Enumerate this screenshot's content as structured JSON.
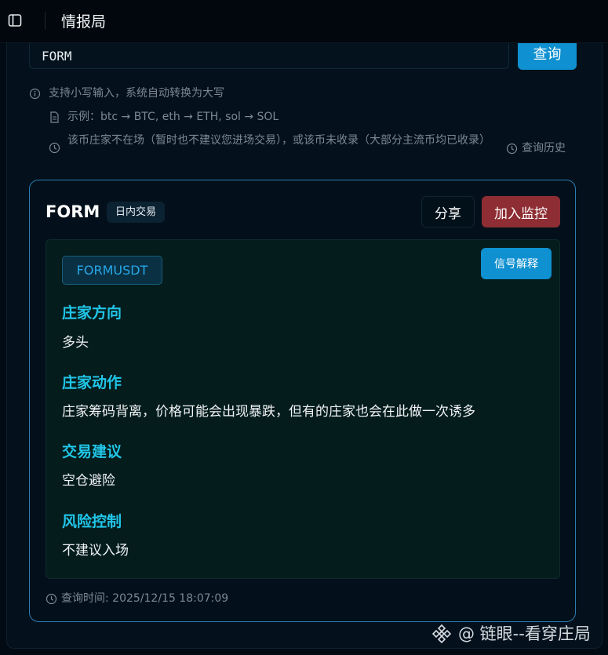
{
  "header": {
    "title": "情报局",
    "icons": {
      "sidebar_toggle": "sidebar-panel-icon"
    }
  },
  "search": {
    "value": "FORM",
    "button_label": "查询"
  },
  "hints": {
    "lowercase": "支持小写输入，系统自动转换为大写",
    "example": "示例：btc → BTC, eth → ETH, sol → SOL",
    "no_dealer": "该币庄家不在场（暂时也不建议您进场交易），或该币未收录（大部分主流币均已收录）",
    "history_link": "查询历史"
  },
  "result": {
    "symbol": "FORM",
    "mode_tag": "日内交易",
    "share_label": "分享",
    "monitor_label": "加入监控",
    "pair": "FORMUSDT",
    "explain_label": "信号解释",
    "sections": [
      {
        "title": "庄家方向",
        "body": "多头"
      },
      {
        "title": "庄家动作",
        "body": "庄家筹码背离，价格可能会出现暴跌，但有的庄家也会在此做一次诱多"
      },
      {
        "title": "交易建议",
        "body": "空仓避险"
      },
      {
        "title": "风险控制",
        "body": "不建议入场"
      }
    ],
    "query_time": "查询时间: 2025/12/15 18:07:09"
  },
  "watermark": {
    "text": "@ 链眼--看穿庄局",
    "icon": "binance-logo-icon"
  },
  "colors": {
    "accent_blue": "#0f90d0",
    "danger_red": "#8e2d33",
    "section_title_cyan": "#21c6e8",
    "card_border": "#2b7cb2"
  }
}
